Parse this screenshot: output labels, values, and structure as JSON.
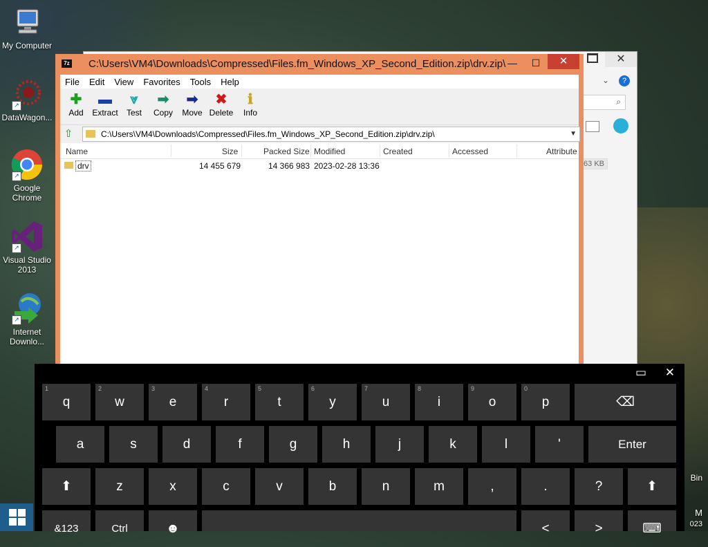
{
  "desktop": {
    "icons": [
      {
        "label": "My Computer",
        "icon": "computer-icon"
      },
      {
        "label": "DataWagon...",
        "icon": "datawagon-icon"
      },
      {
        "label": "Google Chrome",
        "icon": "chrome-icon"
      },
      {
        "label": "Visual Studio 2013",
        "icon": "visual-studio-icon"
      },
      {
        "label": "Internet Downlo...",
        "icon": "idm-icon"
      }
    ],
    "right_partial_text": "Bin",
    "clock_partial_1": "M",
    "clock_partial_2": "023"
  },
  "bg_window": {
    "size_text": "63 KB",
    "close_label": "✕"
  },
  "window": {
    "title": "C:\\Users\\VM4\\Downloads\\Compressed\\Files.fm_Windows_XP_Second_Edition.zip\\drv.zip\\",
    "app_icon": "7z",
    "minimize": "—",
    "maximize": "☐",
    "close": "✕",
    "menu": [
      "File",
      "Edit",
      "View",
      "Favorites",
      "Tools",
      "Help"
    ],
    "toolbar": [
      {
        "label": "Add",
        "icon": "add-icon",
        "glyph": "✚",
        "color": "#1ea01e"
      },
      {
        "label": "Extract",
        "icon": "extract-icon",
        "glyph": "▬",
        "color": "#1a3fa6"
      },
      {
        "label": "Test",
        "icon": "test-icon",
        "glyph": "⩔",
        "color": "#1aa6a6"
      },
      {
        "label": "Copy",
        "icon": "copy-icon",
        "glyph": "➡",
        "color": "#1a8a6a"
      },
      {
        "label": "Move",
        "icon": "move-icon",
        "glyph": "➡",
        "color": "#1a2a8a"
      },
      {
        "label": "Delete",
        "icon": "delete-icon",
        "glyph": "✖",
        "color": "#d01818"
      },
      {
        "label": "Info",
        "icon": "info-icon",
        "glyph": "ℹ",
        "color": "#c8a818"
      }
    ],
    "address": "C:\\Users\\VM4\\Downloads\\Compressed\\Files.fm_Windows_XP_Second_Edition.zip\\drv.zip\\",
    "columns": [
      "Name",
      "Size",
      "Packed Size",
      "Modified",
      "Created",
      "Accessed",
      "Attribute"
    ],
    "rows": [
      {
        "name": "drv",
        "size": "14 455 679",
        "packed": "14 366 983",
        "modified": "2023-02-28 13:36",
        "created": "",
        "accessed": "",
        "attributes": ""
      }
    ]
  },
  "keyboard": {
    "minimize": "▭",
    "close": "✕",
    "row1": [
      {
        "k": "q",
        "n": "1"
      },
      {
        "k": "w",
        "n": "2"
      },
      {
        "k": "e",
        "n": "3"
      },
      {
        "k": "r",
        "n": "4"
      },
      {
        "k": "t",
        "n": "5"
      },
      {
        "k": "y",
        "n": "6"
      },
      {
        "k": "u",
        "n": "7"
      },
      {
        "k": "i",
        "n": "8"
      },
      {
        "k": "o",
        "n": "9"
      },
      {
        "k": "p",
        "n": "0"
      }
    ],
    "backspace": "⌫",
    "row2": [
      "a",
      "s",
      "d",
      "f",
      "g",
      "h",
      "j",
      "k",
      "l",
      "'"
    ],
    "enter": "Enter",
    "shift": "⬆",
    "row3": [
      "z",
      "x",
      "c",
      "v",
      "b",
      "n",
      "m",
      ",",
      ".",
      "?"
    ],
    "row4": {
      "symbols": "&123",
      "ctrl": "Ctrl",
      "emoji": "☻",
      "left": "<",
      "right": ">",
      "kbd": "⌨"
    }
  }
}
